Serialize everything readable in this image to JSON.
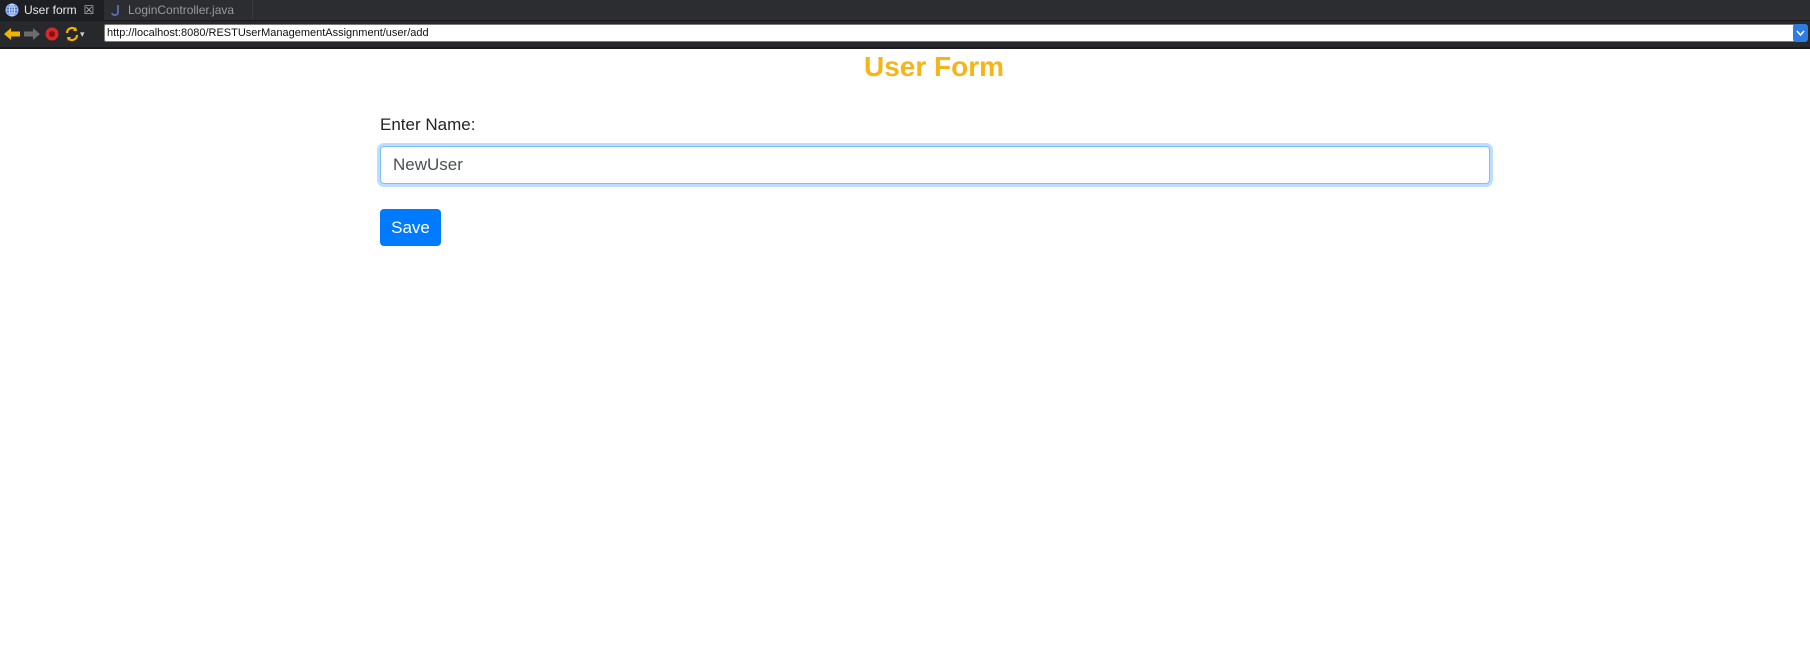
{
  "browser": {
    "tabs": [
      {
        "label": "User form",
        "active": true,
        "icon": "globe-icon"
      },
      {
        "label": "LoginController.java",
        "active": false,
        "icon": "java-file-icon"
      }
    ],
    "address": "http://localhost:8080/RESTUserManagementAssignment/user/add"
  },
  "page": {
    "title": "User Form",
    "name_label": "Enter Name:",
    "name_value": "NewUser",
    "save_label": "Save"
  },
  "colors": {
    "title": "#f5b418",
    "button": "#007bff",
    "toolbar": "#26282c"
  }
}
